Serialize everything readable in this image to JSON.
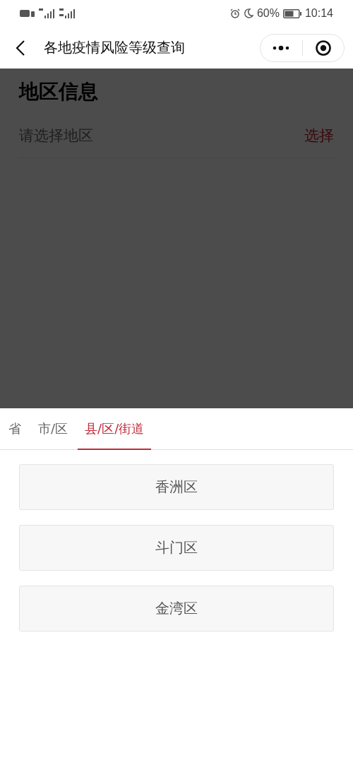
{
  "status_bar": {
    "battery": "60%",
    "time": "10:14"
  },
  "nav_bar": {
    "title": "各地疫情风险等级查询"
  },
  "page": {
    "heading": "地区信息",
    "region_field": {
      "placeholder": "请选择地区"
    },
    "select_link": "选择"
  },
  "sheet": {
    "tabs": [
      {
        "label": "省",
        "selected": false
      },
      {
        "label": "市/区",
        "selected": false
      },
      {
        "label": "县/区/街道",
        "selected": true
      }
    ],
    "options": [
      "香洲区",
      "斗门区",
      "金湾区"
    ]
  }
}
